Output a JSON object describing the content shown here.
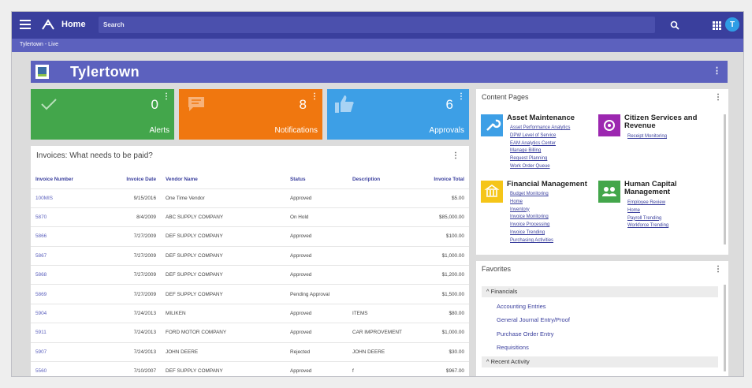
{
  "topbar": {
    "home_label": "Home",
    "search_placeholder": "Search",
    "avatar_initial": "T"
  },
  "breadcrumb": "Tylertown - Live",
  "banner": {
    "title": "Tylertown"
  },
  "tiles": [
    {
      "count": "0",
      "label": "Alerts",
      "color": "#43a64b",
      "icon": "check-icon"
    },
    {
      "count": "8",
      "label": "Notifications",
      "color": "#f0770f",
      "icon": "message-icon"
    },
    {
      "count": "6",
      "label": "Approvals",
      "color": "#3d9fe6",
      "icon": "thumbs-up-icon"
    }
  ],
  "invoices": {
    "title": "Invoices: What needs to be paid?",
    "columns": [
      "Invoice Number",
      "Invoice Date",
      "Vendor Name",
      "Status",
      "Description",
      "Invoice Total"
    ],
    "rows": [
      [
        "100MIS",
        "9/15/2016",
        "One Time Vendor",
        "Approved",
        "",
        "$5.00"
      ],
      [
        "5870",
        "8/4/2009",
        "ABC SUPPLY COMPANY",
        "On Hold",
        "",
        "$85,000.00"
      ],
      [
        "5866",
        "7/27/2009",
        "DEF SUPPLY COMPANY",
        "Approved",
        "",
        "$100.00"
      ],
      [
        "5867",
        "7/27/2009",
        "DEF SUPPLY COMPANY",
        "Approved",
        "",
        "$1,000.00"
      ],
      [
        "5868",
        "7/27/2009",
        "DEF SUPPLY COMPANY",
        "Approved",
        "",
        "$1,200.00"
      ],
      [
        "5869",
        "7/27/2009",
        "DEF SUPPLY COMPANY",
        "Pending Approval",
        "",
        "$1,500.00"
      ],
      [
        "5904",
        "7/24/2013",
        "MILIKEN",
        "Approved",
        "ITEMS",
        "$80.00"
      ],
      [
        "5911",
        "7/24/2013",
        "FORD MOTOR COMPANY",
        "Approved",
        "CAR IMPROVEMENT",
        "$1,000.00"
      ],
      [
        "5907",
        "7/24/2013",
        "JOHN DEERE",
        "Rejected",
        "JOHN DEERE",
        "$30.00"
      ],
      [
        "5560",
        "7/10/2007",
        "DEF SUPPLY COMPANY",
        "Approved",
        "f",
        "$967.00"
      ]
    ]
  },
  "content_pages": {
    "title": "Content Pages",
    "sections": [
      {
        "heading": "Asset Maintenance",
        "icon": "wrench-icon",
        "color": "#3d9fe6",
        "links": [
          "Asset Performance Analytics",
          "DPW Level of Service",
          "EAM Analytics Center",
          "Manage Billing",
          "Request Planning",
          "Work Order Queue"
        ]
      },
      {
        "heading": "Citizen Services and Revenue",
        "icon": "citizen-icon",
        "color": "#9c27b0",
        "links": [
          "Receipt Monitoring"
        ]
      },
      {
        "heading": "Financial Management",
        "icon": "bank-icon",
        "color": "#f5c518",
        "links": [
          "Budget Monitoring",
          "Home",
          "Inventory",
          "Invoice Monitoring",
          "Invoice Processing",
          "Invoice Trending",
          "Purchasing Activities"
        ]
      },
      {
        "heading": "Human Capital Management",
        "icon": "people-icon",
        "color": "#43a64b",
        "links": [
          "Employee Review",
          "Home",
          "Payroll Trending",
          "Workforce Trending"
        ]
      }
    ]
  },
  "favorites": {
    "title": "Favorites",
    "groups": [
      {
        "name": "Financials",
        "items": [
          "Accounting Entries",
          "General Journal Entry/Proof",
          "Purchase Order Entry",
          "Requisitions"
        ]
      },
      {
        "name": "Recent Activity",
        "items": []
      }
    ]
  }
}
